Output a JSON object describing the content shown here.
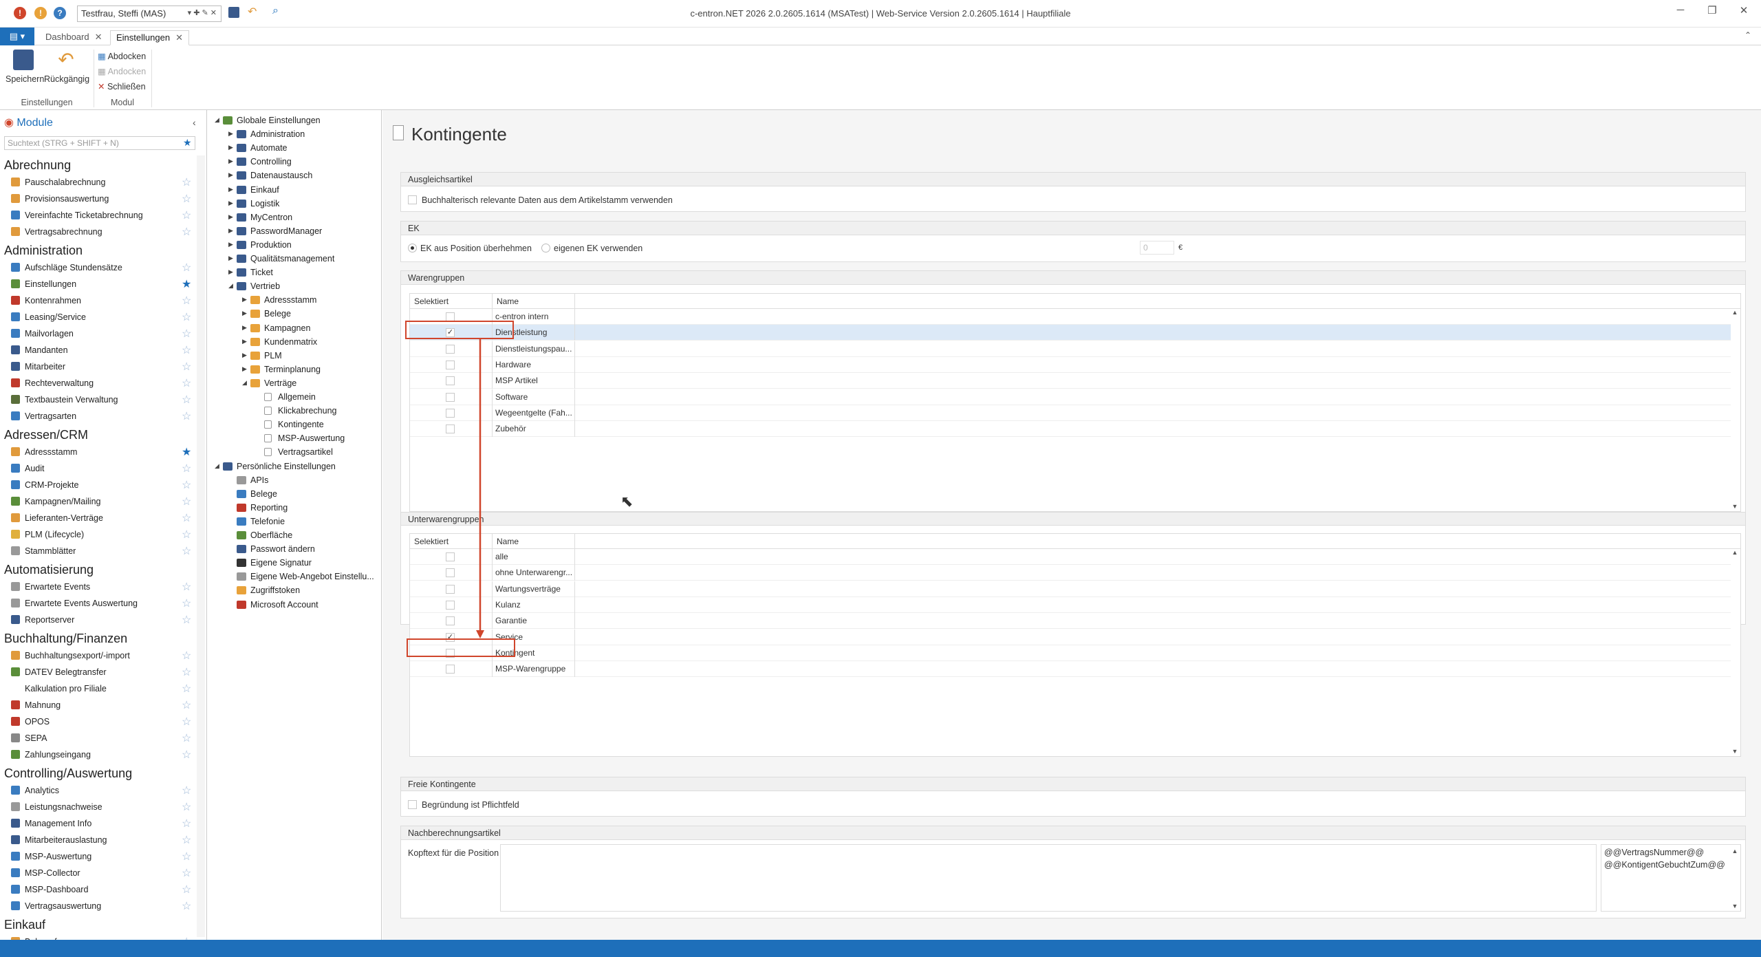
{
  "window": {
    "title": "c-entron.NET 2026 2.0.2605.1614 (MSATest) | Web-Service Version 2.0.2605.1614 | Hauptfiliale",
    "user": "Testfrau, Steffi (MAS)",
    "min": "─",
    "max": "❐",
    "close": "✕"
  },
  "tabs": [
    {
      "label": "Dashboard"
    },
    {
      "label": "Einstellungen"
    }
  ],
  "ribbon": {
    "save": "Speichern",
    "undo": "Rückgängig",
    "group1": "Einstellungen",
    "dock": "Abdocken",
    "attach": "Andocken",
    "close": "Schließen",
    "group2": "Modul"
  },
  "modules": {
    "header": "Module",
    "search_placeholder": "Suchtext (STRG + SHIFT + N)",
    "sections": [
      {
        "title": "Abrechnung",
        "items": [
          {
            "label": "Pauschalabrechnung",
            "color": "#e09a3c"
          },
          {
            "label": "Provisionsauswertung",
            "color": "#e09a3c"
          },
          {
            "label": "Vereinfachte Ticketabrechnung",
            "color": "#3a7cc0"
          },
          {
            "label": "Vertragsabrechnung",
            "color": "#e09a3c"
          }
        ]
      },
      {
        "title": "Administration",
        "items": [
          {
            "label": "Aufschläge Stundensätze",
            "color": "#3a7cc0"
          },
          {
            "label": "Einstellungen",
            "color": "#5a8e3a",
            "starred": true
          },
          {
            "label": "Kontenrahmen",
            "color": "#c0392b"
          },
          {
            "label": "Leasing/Service",
            "color": "#3a7cc0"
          },
          {
            "label": "Mailvorlagen",
            "color": "#3a7cc0"
          },
          {
            "label": "Mandanten",
            "color": "#3a5a8c"
          },
          {
            "label": "Mitarbeiter",
            "color": "#3a5a8c"
          },
          {
            "label": "Rechteverwaltung",
            "color": "#c0392b"
          },
          {
            "label": "Textbaustein Verwaltung",
            "color": "#5a6e3a"
          },
          {
            "label": "Vertragsarten",
            "color": "#3a7cc0"
          }
        ]
      },
      {
        "title": "Adressen/CRM",
        "items": [
          {
            "label": "Adressstamm",
            "color": "#e09a3c",
            "starred": true
          },
          {
            "label": "Audit",
            "color": "#3a7cc0"
          },
          {
            "label": "CRM-Projekte",
            "color": "#3a7cc0"
          },
          {
            "label": "Kampagnen/Mailing",
            "color": "#5a8e3a"
          },
          {
            "label": "Lieferanten-Verträge",
            "color": "#e09a3c"
          },
          {
            "label": "PLM (Lifecycle)",
            "color": "#e0b03c"
          },
          {
            "label": "Stammblätter",
            "color": "#999999"
          }
        ]
      },
      {
        "title": "Automatisierung",
        "items": [
          {
            "label": "Erwartete Events",
            "color": "#999999"
          },
          {
            "label": "Erwartete Events Auswertung",
            "color": "#999999"
          },
          {
            "label": "Reportserver",
            "color": "#3a5a8c"
          }
        ]
      },
      {
        "title": "Buchhaltung/Finanzen",
        "items": [
          {
            "label": "Buchhaltungsexport/-import",
            "color": "#e09a3c"
          },
          {
            "label": "DATEV Belegtransfer",
            "color": "#5a8e3a"
          },
          {
            "label": "Kalkulation pro Filiale",
            "color": "#ffffff"
          },
          {
            "label": "Mahnung",
            "color": "#c0392b"
          },
          {
            "label": "OPOS",
            "color": "#c0392b"
          },
          {
            "label": "SEPA",
            "color": "#888888"
          },
          {
            "label": "Zahlungseingang",
            "color": "#5a8e3a"
          }
        ]
      },
      {
        "title": "Controlling/Auswertung",
        "items": [
          {
            "label": "Analytics",
            "color": "#3a7cc0"
          },
          {
            "label": "Leistungsnachweise",
            "color": "#999999"
          },
          {
            "label": "Management Info",
            "color": "#3a5a8c"
          },
          {
            "label": "Mitarbeiterauslastung",
            "color": "#3a5a8c"
          },
          {
            "label": "MSP-Auswertung",
            "color": "#3a7cc0"
          },
          {
            "label": "MSP-Collector",
            "color": "#3a7cc0"
          },
          {
            "label": "MSP-Dashboard",
            "color": "#3a7cc0"
          },
          {
            "label": "Vertragsauswertung",
            "color": "#3a7cc0"
          }
        ]
      },
      {
        "title": "Einkauf",
        "items": [
          {
            "label": "Belegerfassung",
            "color": "#e09a3c"
          }
        ]
      }
    ]
  },
  "tree": {
    "root": "Globale Einstellungen",
    "level1": [
      "Administration",
      "Automate",
      "Controlling",
      "Datenaustausch",
      "Einkauf",
      "Logistik",
      "MyCentron",
      "PasswordManager",
      "Produktion",
      "Qualitätsmanagement",
      "Ticket"
    ],
    "vertrieb": "Vertrieb",
    "vertrieb_children": [
      "Adressstamm",
      "Belege",
      "Kampagnen",
      "Kundenmatrix",
      "PLM",
      "Terminplanung"
    ],
    "vertraege": "Verträge",
    "vertraege_children": [
      "Allgemein",
      "Klickabrechung",
      "Kontingente",
      "MSP-Auswertung",
      "Vertragsartikel"
    ],
    "personal": "Persönliche Einstellungen",
    "personal_children": [
      "APIs",
      "Belege",
      "Reporting",
      "Telefonie",
      "Oberfläche",
      "Passwort ändern",
      "Eigene Signatur",
      "Eigene Web-Angebot Einstellu...",
      "Zugriffstoken",
      "Microsoft Account"
    ]
  },
  "content": {
    "title": "Kontingente",
    "ausgleich": {
      "header": "Ausgleichsartikel",
      "checkbox": "Buchhalterisch relevante Daten aus dem Artikelstamm verwenden"
    },
    "ek": {
      "header": "EK",
      "opt1": "EK aus Position überhehmen",
      "opt2": "eigenen EK verwenden",
      "value": "0",
      "currency": "€"
    },
    "warengruppen": {
      "header": "Warengruppen",
      "col1": "Selektiert",
      "col2": "Name",
      "rows": [
        {
          "name": "c-entron intern",
          "checked": false
        },
        {
          "name": "Dienstleistung",
          "checked": true
        },
        {
          "name": "Dienstleistungspau...",
          "checked": false
        },
        {
          "name": "Hardware",
          "checked": false
        },
        {
          "name": "MSP Artikel",
          "checked": false
        },
        {
          "name": "Software",
          "checked": false
        },
        {
          "name": "Wegeentgelte (Fah...",
          "checked": false
        },
        {
          "name": "Zubehör",
          "checked": false
        }
      ]
    },
    "unterwaren": {
      "header": "Unterwarengruppen",
      "col1": "Selektiert",
      "col2": "Name",
      "rows": [
        {
          "name": "alle",
          "checked": false
        },
        {
          "name": "ohne Unterwarengr...",
          "checked": false
        },
        {
          "name": "Wartungsverträge",
          "checked": false
        },
        {
          "name": "Kulanz",
          "checked": false
        },
        {
          "name": "Garantie",
          "checked": false
        },
        {
          "name": "Service",
          "checked": true
        },
        {
          "name": "Kontingent",
          "checked": false
        },
        {
          "name": "MSP-Warengruppe",
          "checked": false
        }
      ]
    },
    "freie": {
      "header": "Freie Kontingente",
      "checkbox": "Begründung ist Pflichtfeld"
    },
    "nachberechnung": {
      "header": "Nachberechnungsartikel",
      "label": "Kopftext für die Position",
      "placeholders": [
        "@@VertragsNummer@@",
        "@@KontigentGebuchtZum@@"
      ]
    }
  },
  "colors": {
    "accent": "#1e6fba",
    "highlight": "#d0452b"
  }
}
